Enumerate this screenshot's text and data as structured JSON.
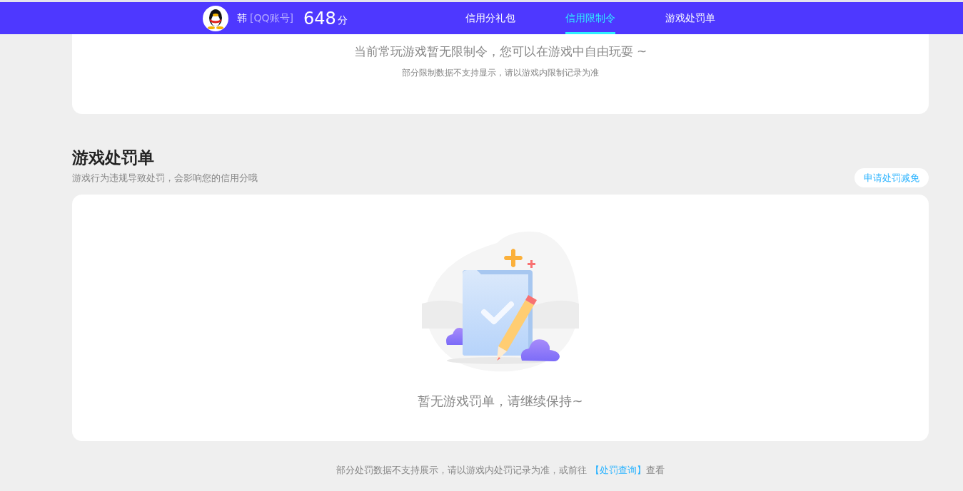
{
  "header": {
    "user_name": "韩",
    "account_type": "[QQ账号]",
    "score": "648",
    "score_unit": "分",
    "tabs": [
      {
        "label": "信用分礼包",
        "selected": false
      },
      {
        "label": "信用限制令",
        "selected": true
      },
      {
        "label": "游戏处罚单",
        "selected": false
      }
    ]
  },
  "restriction_card": {
    "message": "当前常玩游戏暂无限制令，您可以在游戏中自由玩耍 ~",
    "note": "部分限制数据不支持显示，请以游戏内限制记录为准"
  },
  "penalty_section": {
    "title": "游戏处罚单",
    "subtitle": "游戏行为违规导致处罚，会影响您的信用分哦",
    "action_button": "申请处罚减免",
    "empty_message": "暂无游戏罚单，请继续保持~"
  },
  "footer": {
    "text": "部分处罚数据不支持展示，请以游戏内处罚记录为准，或前往 ",
    "link": "【处罚查询】",
    "suffix": "查看"
  }
}
